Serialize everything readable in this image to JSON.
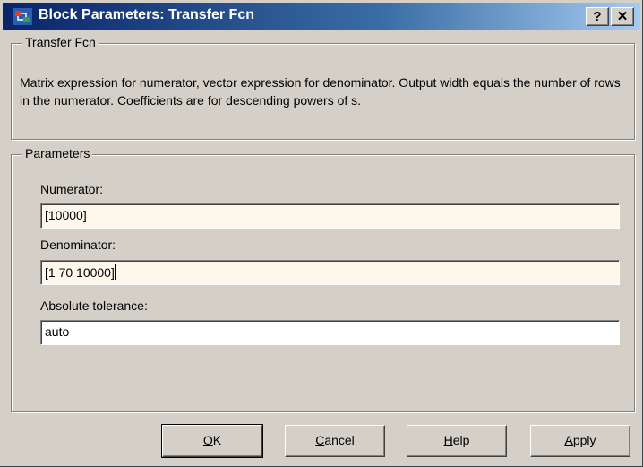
{
  "window": {
    "title": "Block Parameters: Transfer Fcn",
    "help_button": "?",
    "close_button": "✕"
  },
  "icons": {
    "app": "simulink-block-icon"
  },
  "transfer_fcn_group": {
    "legend": "Transfer Fcn",
    "description": "Matrix expression for numerator, vector expression for denominator.  Output width equals the number of rows in the numerator.  Coefficients are for descending powers of s."
  },
  "parameters_group": {
    "legend": "Parameters",
    "numerator_label": "Numerator:",
    "numerator_value": "[10000]",
    "denominator_label": "Denominator:",
    "denominator_value": "[1 70 10000]",
    "abs_tol_label": "Absolute tolerance:",
    "abs_tol_value": "auto"
  },
  "buttons": {
    "ok": {
      "mnemonic": "O",
      "rest": "K"
    },
    "cancel": {
      "mnemonic": "C",
      "rest": "ancel"
    },
    "help": {
      "mnemonic": "H",
      "rest": "elp"
    },
    "apply": {
      "mnemonic": "A",
      "rest": "pply"
    }
  },
  "colors": {
    "titlebar_start": "#0a246a",
    "titlebar_end": "#a6caf0",
    "dialog_bg": "#d4d0c8",
    "edited_field_bg": "#fdf7ec"
  }
}
